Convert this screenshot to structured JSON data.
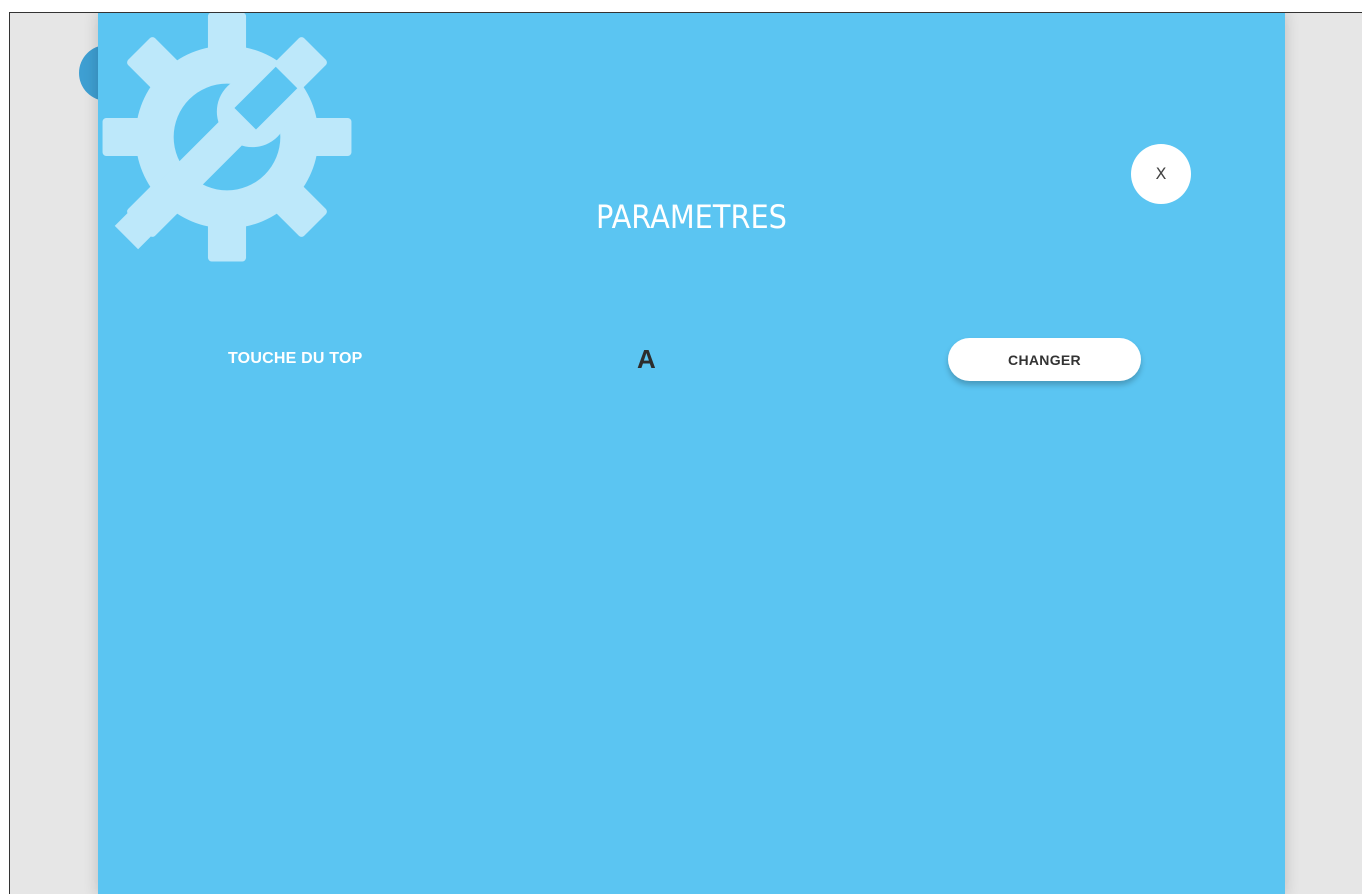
{
  "modal": {
    "title": "PARAMETRES",
    "close_label": "X"
  },
  "settings": [
    {
      "label": "TOUCHE DU TOP",
      "value": "A",
      "button_label": "CHANGER"
    }
  ],
  "icons": {
    "background_button": "gear-icon",
    "header": "settings-gear-wrench-icon"
  },
  "colors": {
    "modal_background": "#5bc5f2",
    "gear_icon": "#bde8fa",
    "page_background": "#e6e6e6",
    "accent_button": "#3e9fd2",
    "button_background": "#ffffff",
    "value_text": "#2d2d2d"
  }
}
